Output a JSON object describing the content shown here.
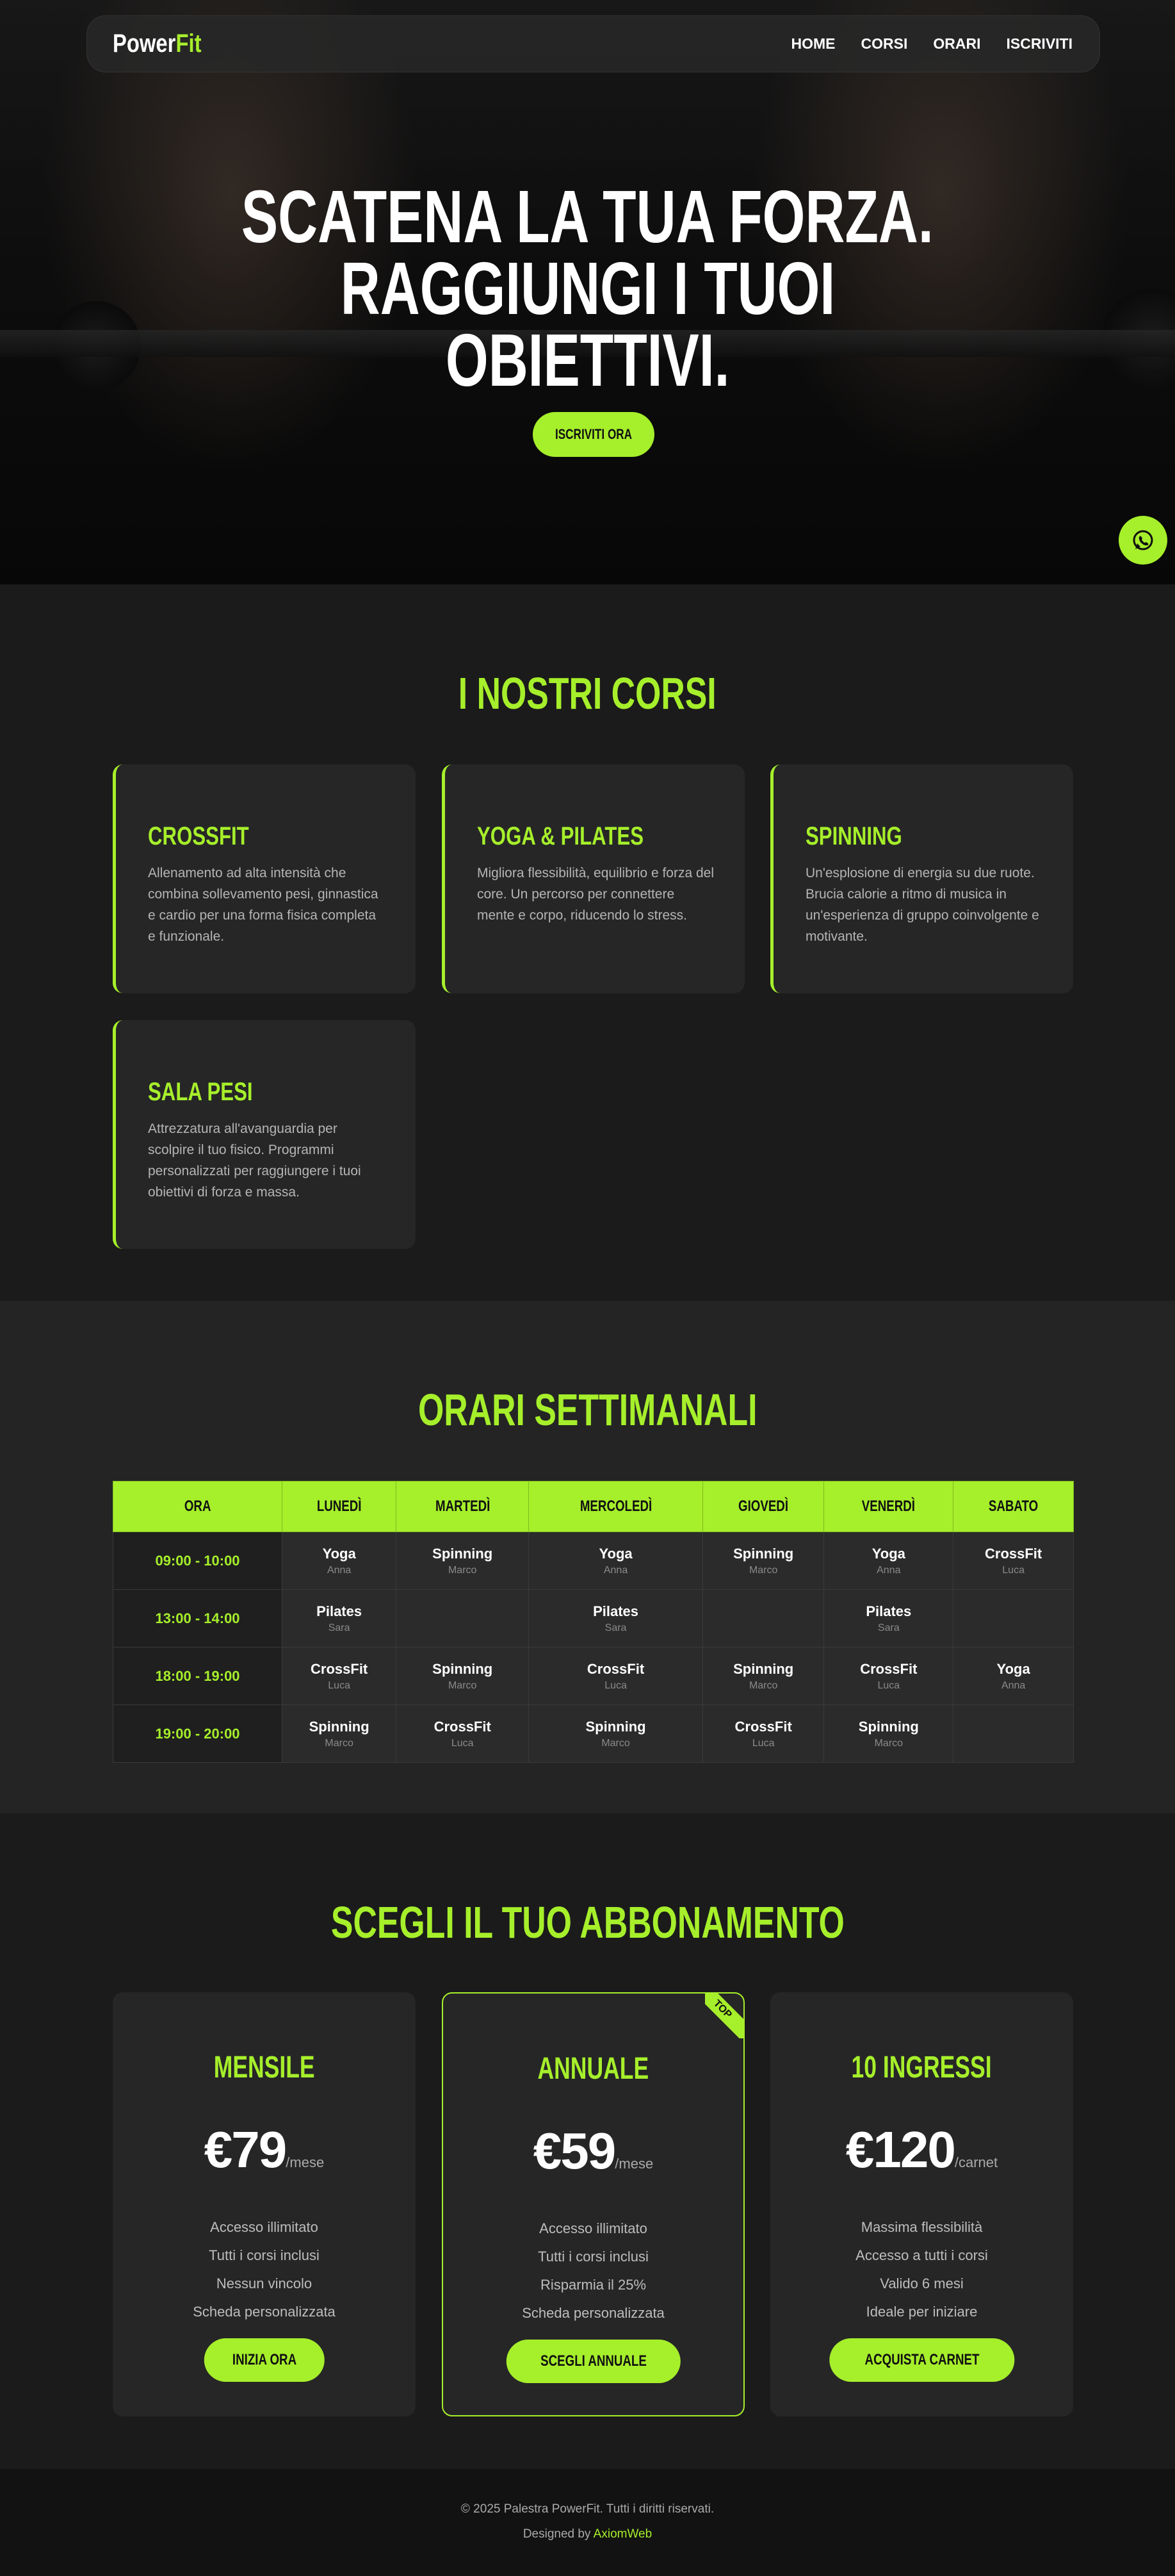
{
  "brand": {
    "name_main": "Power",
    "name_accent": "Fit",
    "accent_color": "#a6ef2b"
  },
  "nav": {
    "items": [
      "HOME",
      "CORSI",
      "ORARI",
      "ISCRIVITI"
    ]
  },
  "hero": {
    "title_line1": "SCATENA LA TUA FORZA.",
    "title_line2": "RAGGIUNGI I TUOI",
    "title_line3": "OBIETTIVI.",
    "cta": "ISCRIVITI ORA"
  },
  "whatsapp": {
    "icon": "whatsapp-icon"
  },
  "courses": {
    "title": "I NOSTRI CORSI",
    "items": [
      {
        "name": "CROSSFIT",
        "desc": "Allenamento ad alta intensità che combina sollevamento pesi, ginnastica e cardio per una forma fisica completa e funzionale."
      },
      {
        "name": "YOGA & PILATES",
        "desc": "Migliora flessibilità, equilibrio e forza del core. Un percorso per connettere mente e corpo, riducendo lo stress."
      },
      {
        "name": "SPINNING",
        "desc": "Un'esplosione di energia su due ruote. Brucia calorie a ritmo di musica in un'esperienza di gruppo coinvolgente e motivante."
      },
      {
        "name": "SALA PESI",
        "desc": "Attrezzatura all'avanguardia per scolpire il tuo fisico. Programmi personalizzati per raggiungere i tuoi obiettivi di forza e massa."
      }
    ]
  },
  "schedule": {
    "title": "ORARI SETTIMANALI",
    "headers": [
      "ORA",
      "LUNEDÌ",
      "MARTEDÌ",
      "MERCOLEDÌ",
      "GIOVEDÌ",
      "VENERDÌ",
      "SABATO"
    ],
    "rows": [
      {
        "time": "09:00 - 10:00",
        "cells": [
          {
            "c": "Yoga",
            "i": "Anna"
          },
          {
            "c": "Spinning",
            "i": "Marco"
          },
          {
            "c": "Yoga",
            "i": "Anna"
          },
          {
            "c": "Spinning",
            "i": "Marco"
          },
          {
            "c": "Yoga",
            "i": "Anna"
          },
          {
            "c": "CrossFit",
            "i": "Luca"
          }
        ]
      },
      {
        "time": "13:00 - 14:00",
        "cells": [
          {
            "c": "Pilates",
            "i": "Sara"
          },
          {
            "c": "",
            "i": ""
          },
          {
            "c": "Pilates",
            "i": "Sara"
          },
          {
            "c": "",
            "i": ""
          },
          {
            "c": "Pilates",
            "i": "Sara"
          },
          {
            "c": "",
            "i": ""
          }
        ]
      },
      {
        "time": "18:00 - 19:00",
        "cells": [
          {
            "c": "CrossFit",
            "i": "Luca"
          },
          {
            "c": "Spinning",
            "i": "Marco"
          },
          {
            "c": "CrossFit",
            "i": "Luca"
          },
          {
            "c": "Spinning",
            "i": "Marco"
          },
          {
            "c": "CrossFit",
            "i": "Luca"
          },
          {
            "c": "Yoga",
            "i": "Anna"
          }
        ]
      },
      {
        "time": "19:00 - 20:00",
        "cells": [
          {
            "c": "Spinning",
            "i": "Marco"
          },
          {
            "c": "CrossFit",
            "i": "Luca"
          },
          {
            "c": "Spinning",
            "i": "Marco"
          },
          {
            "c": "CrossFit",
            "i": "Luca"
          },
          {
            "c": "Spinning",
            "i": "Marco"
          },
          {
            "c": "",
            "i": ""
          }
        ]
      }
    ]
  },
  "pricing": {
    "title": "SCEGLI IL TUO ABBONAMENTO",
    "plans": [
      {
        "name": "MENSILE",
        "price": "€79",
        "period": "/mese",
        "features": [
          "Accesso illimitato",
          "Tutti i corsi inclusi",
          "Nessun vincolo",
          "Scheda personalizzata"
        ],
        "cta": "INIZIA ORA"
      },
      {
        "name": "ANNUALE",
        "price": "€59",
        "period": "/mese",
        "features": [
          "Accesso illimitato",
          "Tutti i corsi inclusi",
          "Risparmia il 25%",
          "Scheda personalizzata"
        ],
        "cta": "SCEGLI ANNUALE",
        "badge": "TOP"
      },
      {
        "name": "10 INGRESSI",
        "price": "€120",
        "period": "/carnet",
        "features": [
          "Massima flessibilità",
          "Accesso a tutti i corsi",
          "Valido 6 mesi",
          "Ideale per iniziare"
        ],
        "cta": "ACQUISTA CARNET"
      }
    ]
  },
  "footer": {
    "copyright": "© 2025 Palestra PowerFit. Tutti i diritti riservati.",
    "designed_by_prefix": "Designed by ",
    "designer": "AxiomWeb"
  }
}
